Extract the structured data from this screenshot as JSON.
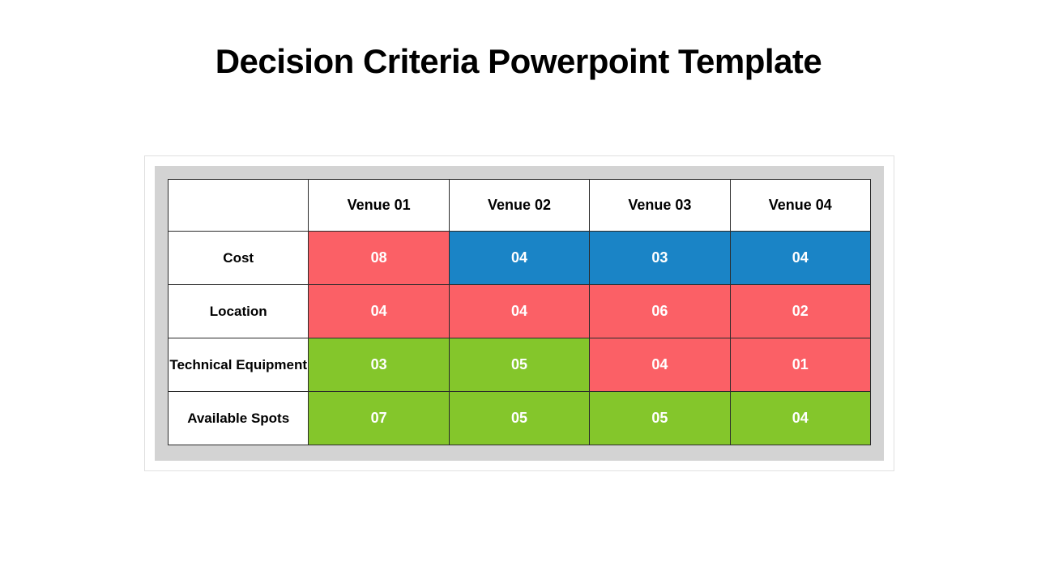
{
  "title": "Decision Criteria Powerpoint Template",
  "columns": [
    "Venue 01",
    "Venue 02",
    "Venue 03",
    "Venue 04"
  ],
  "rows": [
    {
      "label": "Cost",
      "cells": [
        {
          "value": "08",
          "color": "red"
        },
        {
          "value": "04",
          "color": "blue"
        },
        {
          "value": "03",
          "color": "blue"
        },
        {
          "value": "04",
          "color": "blue"
        }
      ]
    },
    {
      "label": "Location",
      "cells": [
        {
          "value": "04",
          "color": "red"
        },
        {
          "value": "04",
          "color": "red"
        },
        {
          "value": "06",
          "color": "red"
        },
        {
          "value": "02",
          "color": "red"
        }
      ]
    },
    {
      "label": "Technical Equipment",
      "cells": [
        {
          "value": "03",
          "color": "green"
        },
        {
          "value": "05",
          "color": "green"
        },
        {
          "value": "04",
          "color": "red"
        },
        {
          "value": "01",
          "color": "red"
        }
      ]
    },
    {
      "label": "Available Spots",
      "cells": [
        {
          "value": "07",
          "color": "green"
        },
        {
          "value": "05",
          "color": "green"
        },
        {
          "value": "05",
          "color": "green"
        },
        {
          "value": "04",
          "color": "green"
        }
      ]
    }
  ],
  "chart_data": {
    "type": "table",
    "title": "Decision Criteria Powerpoint Template",
    "columns": [
      "Venue 01",
      "Venue 02",
      "Venue 03",
      "Venue 04"
    ],
    "rows": [
      "Cost",
      "Location",
      "Technical Equipment",
      "Available Spots"
    ],
    "values": [
      [
        8,
        4,
        3,
        4
      ],
      [
        4,
        4,
        6,
        2
      ],
      [
        3,
        5,
        4,
        1
      ],
      [
        7,
        5,
        5,
        4
      ]
    ],
    "cell_colors": [
      [
        "red",
        "blue",
        "blue",
        "blue"
      ],
      [
        "red",
        "red",
        "red",
        "red"
      ],
      [
        "green",
        "green",
        "red",
        "red"
      ],
      [
        "green",
        "green",
        "green",
        "green"
      ]
    ],
    "color_legend": {
      "red": "#fb6066",
      "blue": "#1a84c6",
      "green": "#84c62b"
    }
  }
}
